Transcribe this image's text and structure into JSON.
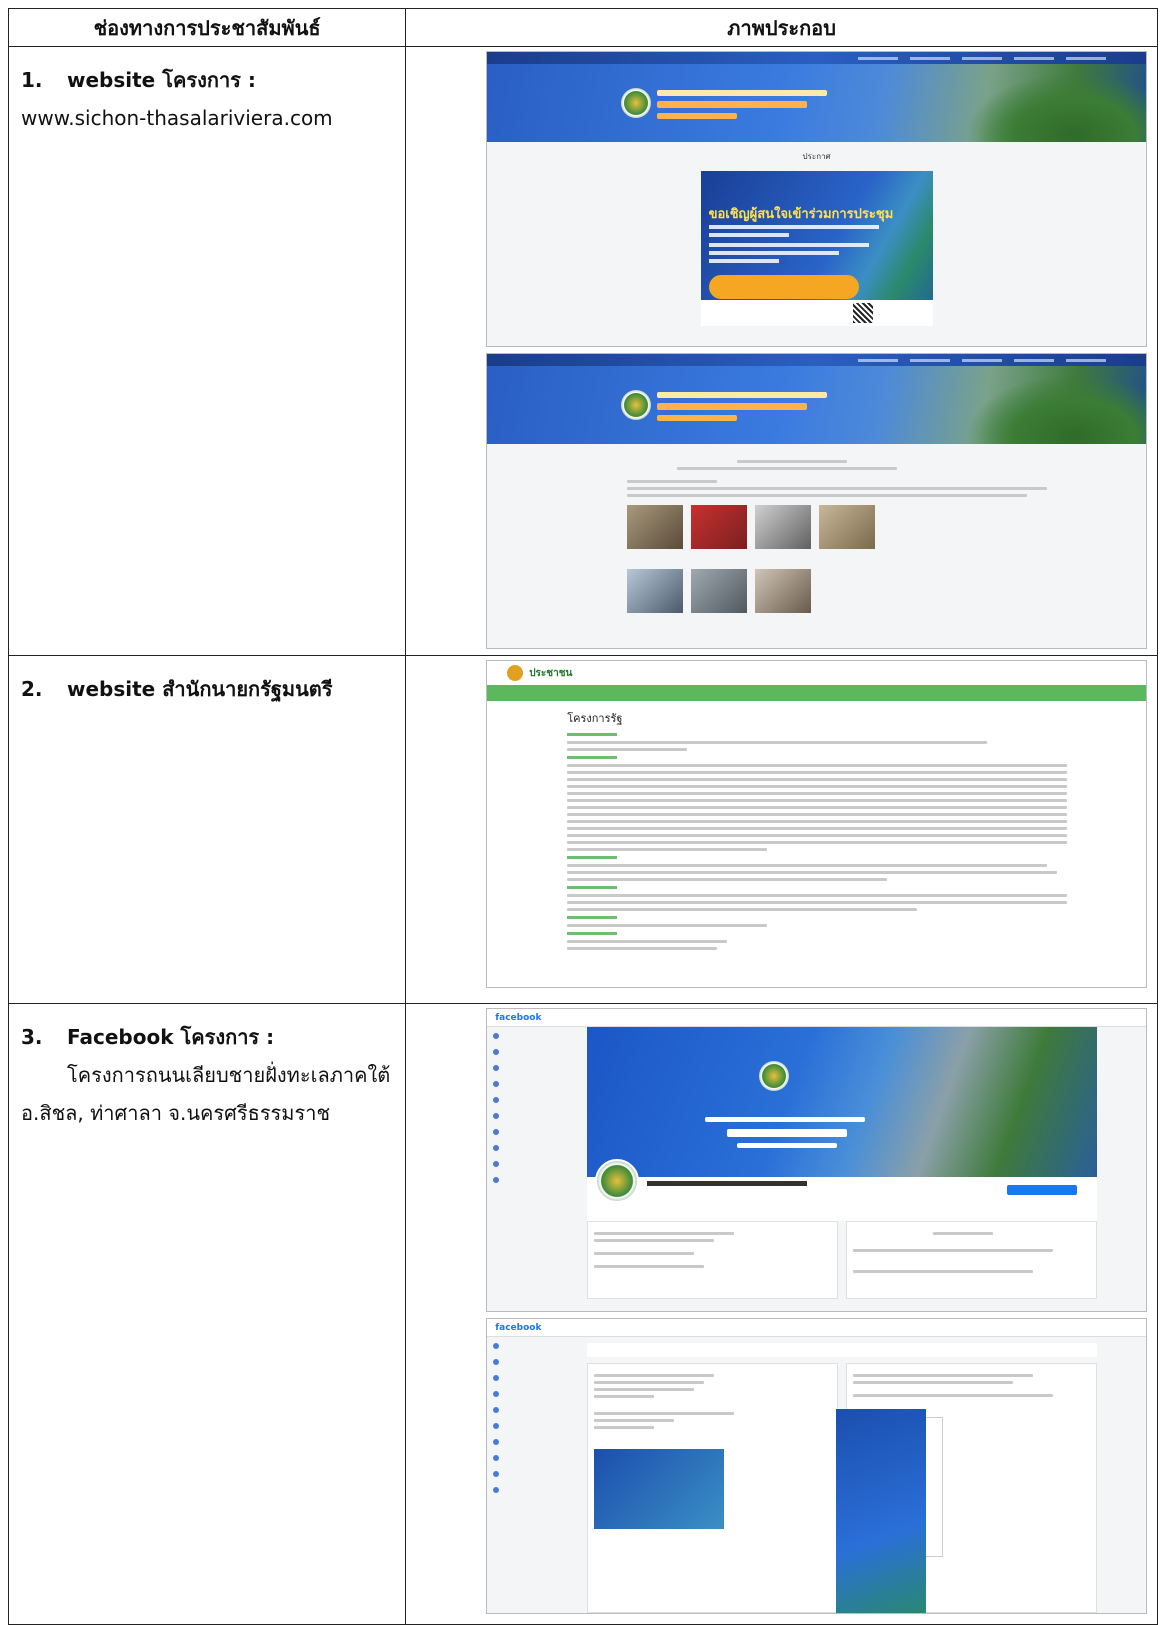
{
  "header": {
    "col1": "ช่องทางการประชาสัมพันธ์",
    "col2": "ภาพประกอบ"
  },
  "rows": [
    {
      "num": "1.",
      "title": "website โครงการ :",
      "detail": "www.sichon-thasalariviera.com"
    },
    {
      "num": "2.",
      "title": "website สำนักนายกรัฐมนตรี"
    },
    {
      "num": "3.",
      "title": "Facebook โครงการ :",
      "detail_line1": "โครงการถนนเลียบชายฝั่งทะเลภาคใต้",
      "detail_line2": "อ.สิชล, ท่าศาลา จ.นครศรีธรรมราช"
    }
  ],
  "screens": {
    "site1_caption": "ประกาศ",
    "poster_headline": "ขอเชิญผู้สนใจเข้าร่วมการประชุม",
    "gov_site_brand": "ประชาชน",
    "gov_site_heading": "โครงการรัฐ",
    "fb_brand": "facebook",
    "colors": {
      "banner_blue": "#2a5fc4",
      "gov_green": "#5cb85c",
      "fb_blue": "#1877f2"
    }
  }
}
